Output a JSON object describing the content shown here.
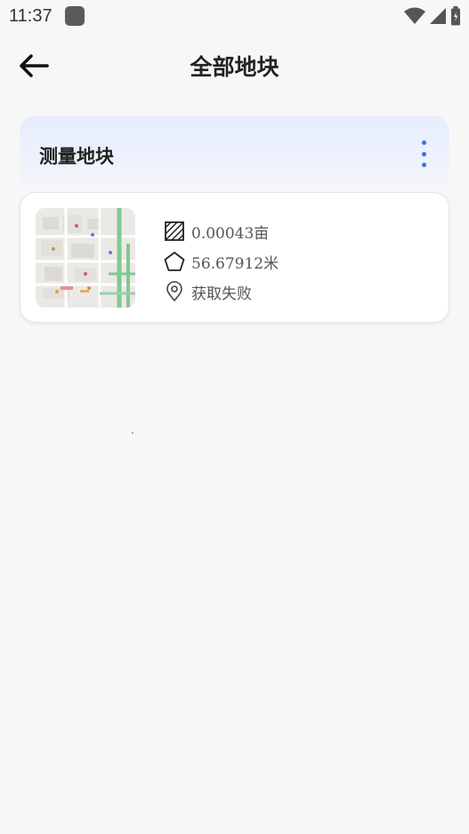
{
  "status_bar": {
    "time": "11:37",
    "icons": [
      "app-icon",
      "wifi-icon",
      "signal-icon",
      "battery-icon"
    ]
  },
  "header": {
    "back_icon": "arrow-left-icon",
    "title": "全部地块"
  },
  "section": {
    "title": "测量地块",
    "menu_icon": "more-vertical-icon",
    "accent_color": "#3b6fe0"
  },
  "plot": {
    "thumbnail": "map-thumbnail",
    "area": "0.00043亩",
    "perimeter": "56.67912米",
    "location": "获取失败",
    "area_icon": "area-icon",
    "perimeter_icon": "pentagon-icon",
    "location_icon": "location-pin-icon"
  }
}
